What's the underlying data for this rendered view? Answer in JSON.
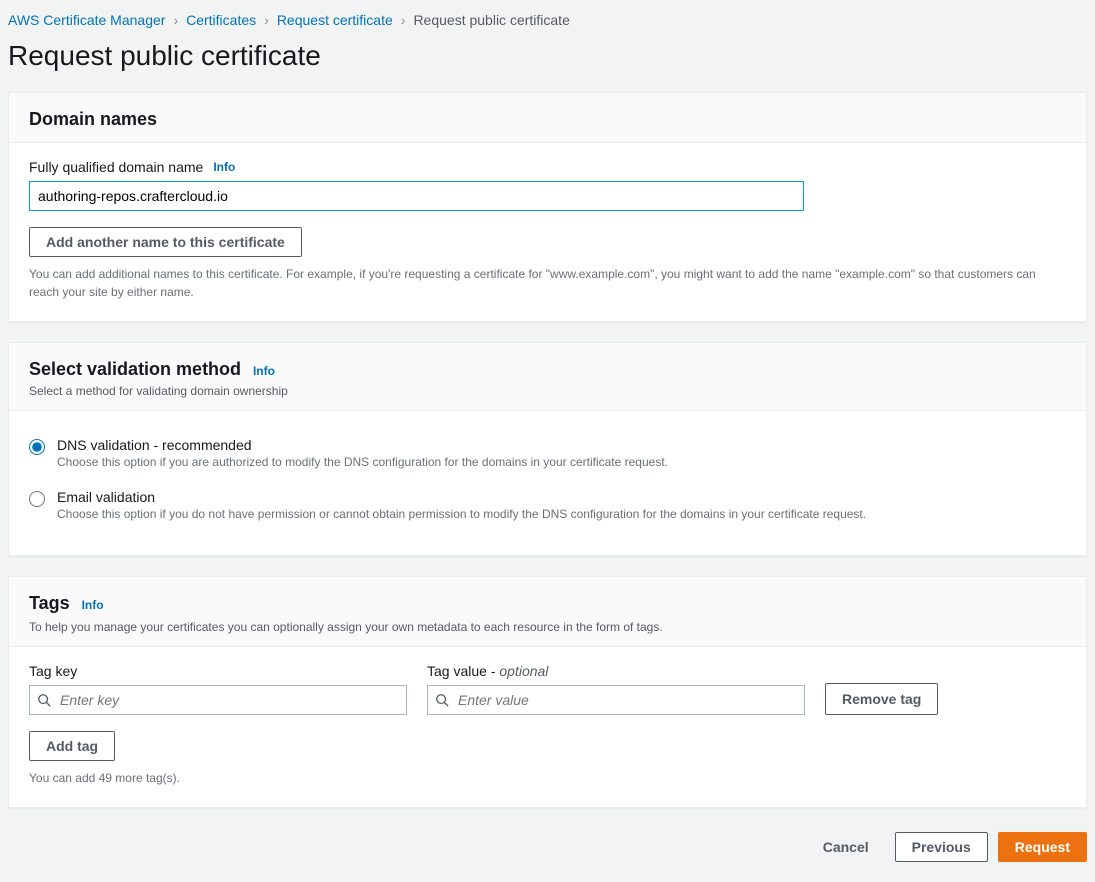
{
  "breadcrumb": {
    "items": [
      {
        "label": "AWS Certificate Manager",
        "link": true
      },
      {
        "label": "Certificates",
        "link": true
      },
      {
        "label": "Request certificate",
        "link": true
      },
      {
        "label": "Request public certificate",
        "link": false
      }
    ]
  },
  "page_title": "Request public certificate",
  "info_label": "Info",
  "domain_names": {
    "title": "Domain names",
    "fqdn_label": "Fully qualified domain name",
    "value": "authoring-repos.craftercloud.io",
    "add_button": "Add another name to this certificate",
    "helper": "You can add additional names to this certificate. For example, if you're requesting a certificate for \"www.example.com\", you might want to add the name \"example.com\" so that customers can reach your site by either name."
  },
  "validation": {
    "title": "Select validation method",
    "subtext": "Select a method for validating domain ownership",
    "options": [
      {
        "title": "DNS validation - recommended",
        "desc": "Choose this option if you are authorized to modify the DNS configuration for the domains in your certificate request.",
        "selected": true
      },
      {
        "title": "Email validation",
        "desc": "Choose this option if you do not have permission or cannot obtain permission to modify the DNS configuration for the domains in your certificate request.",
        "selected": false
      }
    ]
  },
  "tags": {
    "title": "Tags",
    "subtext": "To help you manage your certificates you can optionally assign your own metadata to each resource in the form of tags.",
    "key_label": "Tag key",
    "value_label": "Tag value - ",
    "value_optional": "optional",
    "key_placeholder": "Enter key",
    "value_placeholder": "Enter value",
    "remove_button": "Remove tag",
    "add_button": "Add tag",
    "remaining": "You can add 49 more tag(s)."
  },
  "footer": {
    "cancel": "Cancel",
    "previous": "Previous",
    "request": "Request"
  }
}
